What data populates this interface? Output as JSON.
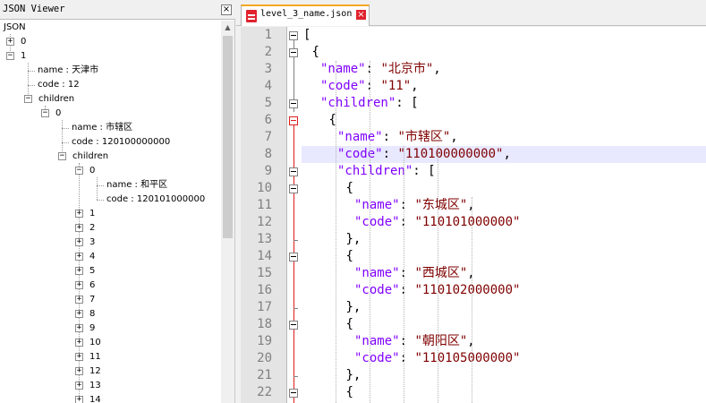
{
  "json_viewer": {
    "title": "JSON Viewer",
    "close_label": "×",
    "root_label": "JSON",
    "nodes": {
      "n0": "0",
      "n1": "1",
      "n1_name": "name : 天津市",
      "n1_code": "code : 12",
      "n1_children": "children",
      "n1c0": "0",
      "n1c0_name": "name : 市辖区",
      "n1c0_code": "code : 120100000000",
      "n1c0_children": "children",
      "n1c0c0": "0",
      "n1c0c0_name": "name : 和平区",
      "n1c0c0_code": "code : 120101000000",
      "items": [
        "1",
        "2",
        "3",
        "4",
        "5",
        "6",
        "7",
        "8",
        "9",
        "10",
        "11",
        "12",
        "13",
        "14"
      ]
    }
  },
  "tab": {
    "filename": "level_3_name.json",
    "close_label": "×"
  },
  "editor": {
    "line_numbers": [
      "1",
      "2",
      "3",
      "4",
      "5",
      "6",
      "7",
      "8",
      "9",
      "10",
      "11",
      "12",
      "13",
      "14",
      "15",
      "16",
      "17",
      "18",
      "19",
      "20",
      "21",
      "22"
    ],
    "lines": [
      [
        {
          "t": "[",
          "c": "p"
        }
      ],
      [
        {
          "t": "{",
          "c": "p"
        }
      ],
      [
        {
          "t": "\"name\"",
          "c": "k"
        },
        {
          "t": ": ",
          "c": "p"
        },
        {
          "t": "\"北京市\"",
          "c": "s"
        },
        {
          "t": ",",
          "c": "p"
        }
      ],
      [
        {
          "t": "\"code\"",
          "c": "k"
        },
        {
          "t": ": ",
          "c": "p"
        },
        {
          "t": "\"11\"",
          "c": "s"
        },
        {
          "t": ",",
          "c": "p"
        }
      ],
      [
        {
          "t": "\"children\"",
          "c": "k"
        },
        {
          "t": ": [",
          "c": "p"
        }
      ],
      [
        {
          "t": "{",
          "c": "p"
        }
      ],
      [
        {
          "t": "\"name\"",
          "c": "k"
        },
        {
          "t": ": ",
          "c": "p"
        },
        {
          "t": "\"市辖区\"",
          "c": "s"
        },
        {
          "t": ",",
          "c": "p"
        }
      ],
      [
        {
          "t": "\"code\"",
          "c": "k"
        },
        {
          "t": ": ",
          "c": "p"
        },
        {
          "t": "\"110100000000\"",
          "c": "s"
        },
        {
          "t": ",",
          "c": "p"
        }
      ],
      [
        {
          "t": "\"children\"",
          "c": "k"
        },
        {
          "t": ": [",
          "c": "p"
        }
      ],
      [
        {
          "t": "{",
          "c": "p"
        }
      ],
      [
        {
          "t": "\"name\"",
          "c": "k"
        },
        {
          "t": ": ",
          "c": "p"
        },
        {
          "t": "\"东城区\"",
          "c": "s"
        },
        {
          "t": ",",
          "c": "p"
        }
      ],
      [
        {
          "t": "\"code\"",
          "c": "k"
        },
        {
          "t": ": ",
          "c": "p"
        },
        {
          "t": "\"110101000000\"",
          "c": "s"
        }
      ],
      [
        {
          "t": "},",
          "c": "p"
        }
      ],
      [
        {
          "t": "{",
          "c": "p"
        }
      ],
      [
        {
          "t": "\"name\"",
          "c": "k"
        },
        {
          "t": ": ",
          "c": "p"
        },
        {
          "t": "\"西城区\"",
          "c": "s"
        },
        {
          "t": ",",
          "c": "p"
        }
      ],
      [
        {
          "t": "\"code\"",
          "c": "k"
        },
        {
          "t": ": ",
          "c": "p"
        },
        {
          "t": "\"110102000000\"",
          "c": "s"
        }
      ],
      [
        {
          "t": "},",
          "c": "p"
        }
      ],
      [
        {
          "t": "{",
          "c": "p"
        }
      ],
      [
        {
          "t": "\"name\"",
          "c": "k"
        },
        {
          "t": ": ",
          "c": "p"
        },
        {
          "t": "\"朝阳区\"",
          "c": "s"
        },
        {
          "t": ",",
          "c": "p"
        }
      ],
      [
        {
          "t": "\"code\"",
          "c": "k"
        },
        {
          "t": ": ",
          "c": "p"
        },
        {
          "t": "\"110105000000\"",
          "c": "s"
        }
      ],
      [
        {
          "t": "},",
          "c": "p"
        }
      ],
      [
        {
          "t": "{",
          "c": "p"
        }
      ]
    ]
  },
  "colors": {
    "key": "#8000ff",
    "string": "#800000",
    "fold_active": "#e01d1d",
    "caret_line": "#e8e8ff",
    "tab_accent": "#f5a623"
  }
}
